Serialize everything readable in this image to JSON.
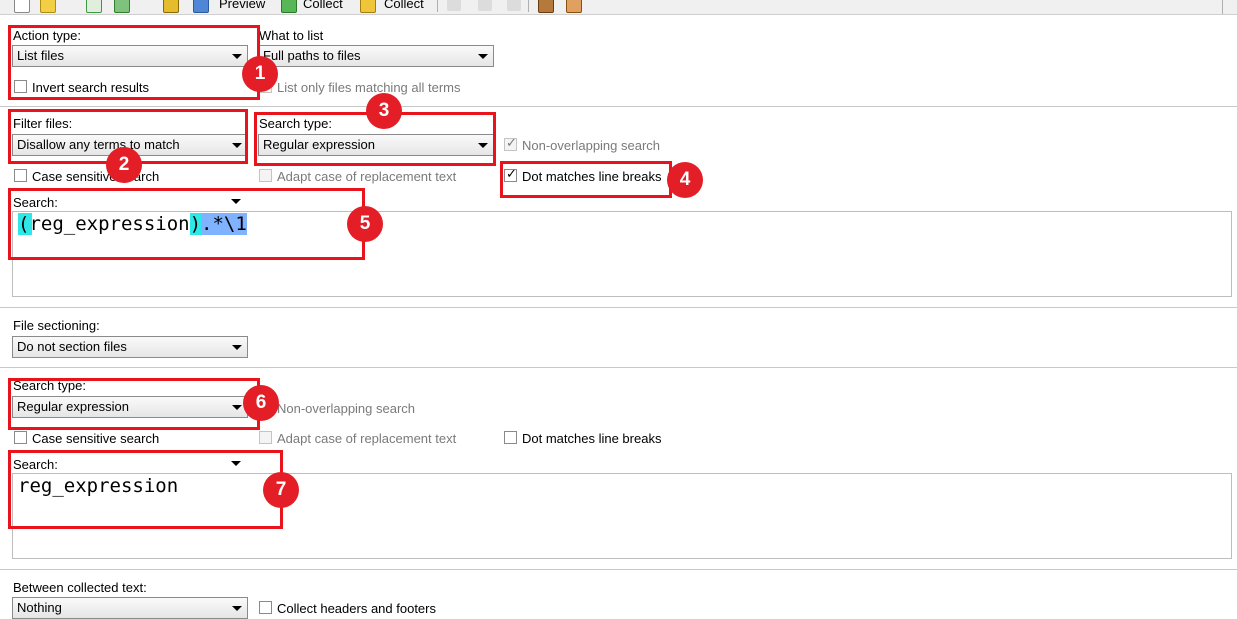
{
  "toolbar": {
    "preview_label": "Preview",
    "collect_label_1": "Collect",
    "collect_label_2": "Collect"
  },
  "action_type": {
    "label": "Action type:",
    "value": "List files",
    "invert_label": "Invert search results",
    "invert_checked": false
  },
  "what_to_list": {
    "label": "What to list",
    "value": "Full paths to files",
    "only_matching_label": "List only files matching all terms"
  },
  "filter_files": {
    "label": "Filter files:",
    "value": "Disallow any terms to match",
    "case_sensitive_label": "Case sensitive search"
  },
  "search_type_1": {
    "label": "Search type:",
    "value": "Regular expression",
    "non_overlapping_label": "Non-overlapping search",
    "adapt_case_label": "Adapt case of replacement text",
    "dot_matches_label": "Dot matches line breaks",
    "dot_checked": true
  },
  "search_1": {
    "label": "Search:",
    "group": "(reg_expression)",
    "tail": ".*\\1"
  },
  "file_sectioning": {
    "label": "File sectioning:",
    "value": "Do not section files"
  },
  "search_type_2": {
    "label": "Search type:",
    "value": "Regular expression",
    "non_overlapping_label": "Non-overlapping search",
    "case_sensitive_label": "Case sensitive search",
    "adapt_case_label": "Adapt case of replacement text",
    "dot_matches_label": "Dot matches line breaks",
    "dot_checked": false
  },
  "search_2": {
    "label": "Search:",
    "value": "reg_expression"
  },
  "between_collected": {
    "label": "Between collected text:",
    "value": "Nothing",
    "headers_footers_label": "Collect headers and footers"
  },
  "badges": [
    "1",
    "2",
    "3",
    "4",
    "5",
    "6",
    "7"
  ],
  "colors": {
    "annotation_red": "#e41e26",
    "regex_group_highlight": "#2ee8e8",
    "regex_tail_highlight": "#7fb2ff"
  }
}
